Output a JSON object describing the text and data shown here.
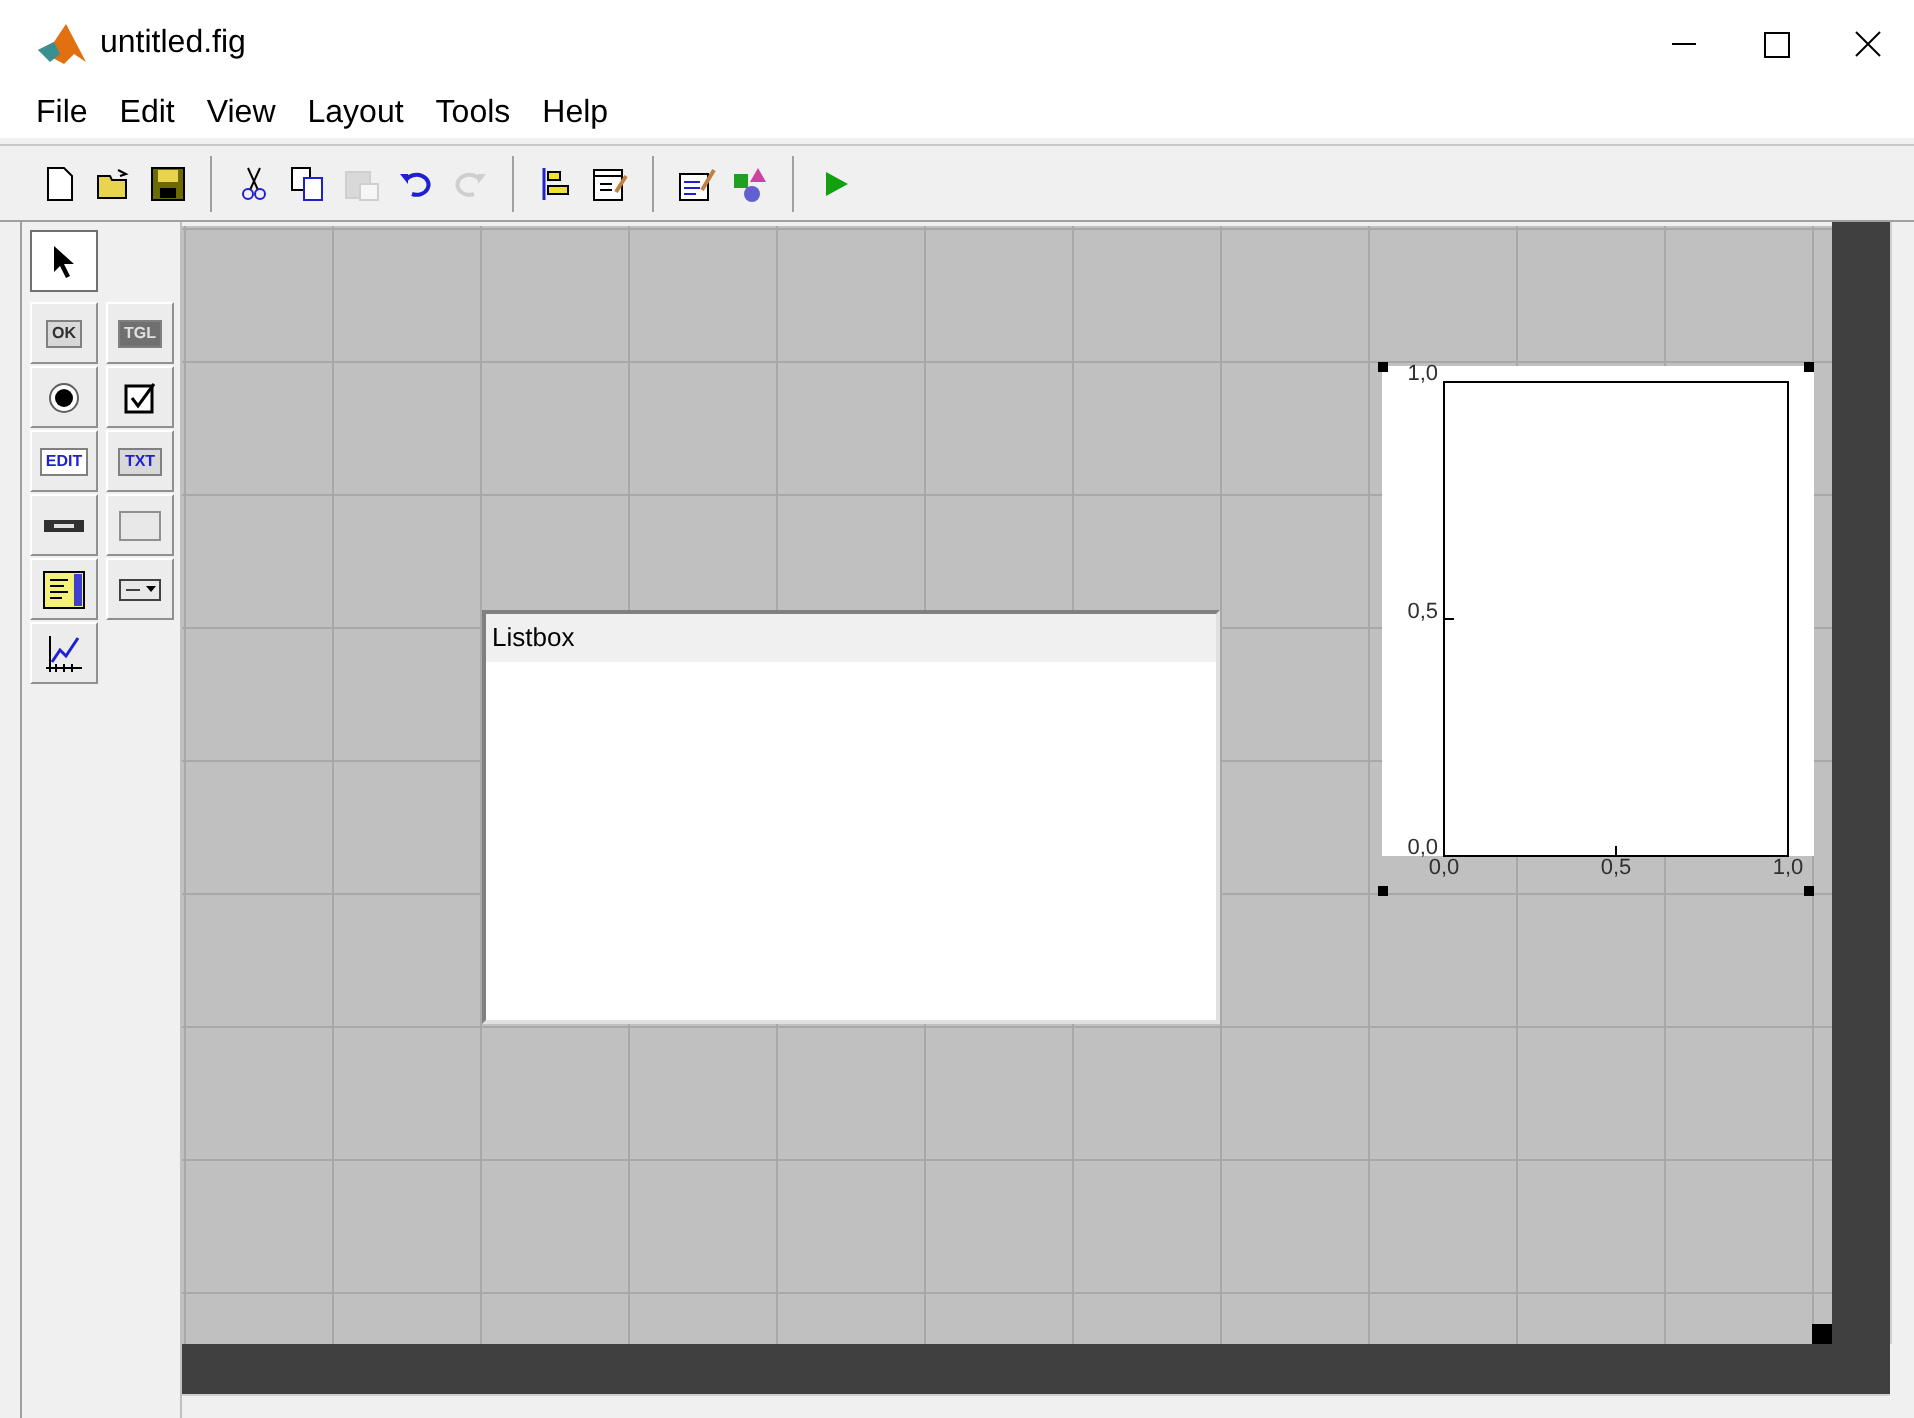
{
  "window": {
    "title": "untitled.fig"
  },
  "menu": [
    "File",
    "Edit",
    "View",
    "Layout",
    "Tools",
    "Help"
  ],
  "toolbar": [
    {
      "kind": "new",
      "disabled": false
    },
    {
      "kind": "open",
      "disabled": false
    },
    {
      "kind": "save",
      "disabled": false
    },
    {
      "kind": "separator"
    },
    {
      "kind": "cut",
      "disabled": false
    },
    {
      "kind": "copy",
      "disabled": false
    },
    {
      "kind": "paste",
      "disabled": true
    },
    {
      "kind": "undo",
      "disabled": false
    },
    {
      "kind": "redo",
      "disabled": true
    },
    {
      "kind": "separator"
    },
    {
      "kind": "align",
      "disabled": false
    },
    {
      "kind": "menu-editor",
      "disabled": false
    },
    {
      "kind": "separator"
    },
    {
      "kind": "editor",
      "disabled": false
    },
    {
      "kind": "browser",
      "disabled": false
    },
    {
      "kind": "separator"
    },
    {
      "kind": "run",
      "disabled": false
    }
  ],
  "palette": [
    {
      "kind": "select",
      "selected": true
    },
    {
      "kind": "push",
      "label": "OK",
      "selected": false
    },
    {
      "kind": "toggle",
      "label": "TGL",
      "selected": false
    },
    {
      "kind": "radio",
      "selected": false
    },
    {
      "kind": "check",
      "selected": false
    },
    {
      "kind": "edit",
      "label": "EDIT",
      "selected": false
    },
    {
      "kind": "text",
      "label": "TXT",
      "selected": false
    },
    {
      "kind": "slider",
      "selected": false
    },
    {
      "kind": "frame",
      "selected": false
    },
    {
      "kind": "listbox",
      "selected": false
    },
    {
      "kind": "popup",
      "selected": false
    },
    {
      "kind": "axes",
      "selected": false
    }
  ],
  "listbox": {
    "label": "Listbox"
  },
  "axes": {
    "chart_data": {
      "type": "line",
      "xlim": [
        0,
        1
      ],
      "ylim": [
        0,
        1
      ],
      "xticks": [
        {
          "value": 0,
          "label": "0,0"
        },
        {
          "value": 0.5,
          "label": "0,5"
        },
        {
          "value": 1,
          "label": "1,0"
        }
      ],
      "yticks": [
        {
          "value": 0,
          "label": "0,0"
        },
        {
          "value": 0.5,
          "label": "0,5"
        },
        {
          "value": 1,
          "label": "1,0"
        }
      ]
    }
  }
}
